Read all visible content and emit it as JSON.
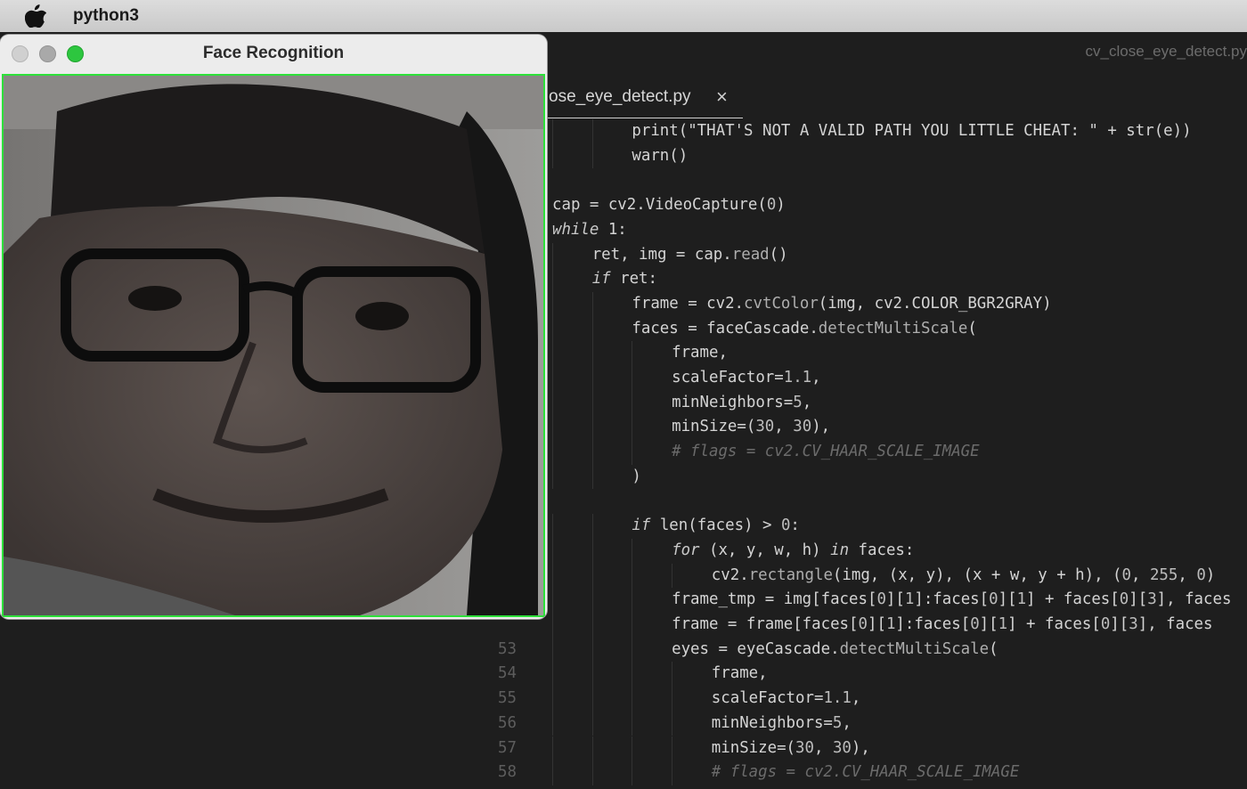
{
  "menubar": {
    "app_name": "python3"
  },
  "ide": {
    "title": "cv_close_eye_detect.py",
    "tab": {
      "label": "ose_eye_detect.py",
      "close": "×"
    }
  },
  "face_window": {
    "title": "Face Recognition"
  },
  "code_lines": [
    {
      "n": "",
      "indent": 2,
      "tokens": [
        [
          "t",
          "print(\"THAT'S NOT A VALID PATH YOU LITTLE CHEAT: \" + str(e))"
        ]
      ]
    },
    {
      "n": "",
      "indent": 2,
      "tokens": [
        [
          "t",
          "warn()"
        ]
      ]
    },
    {
      "n": "",
      "indent": 0,
      "tokens": []
    },
    {
      "n": "",
      "indent": 0,
      "tokens": [
        [
          "t",
          "cap = cv2.VideoCapture("
        ],
        [
          "num",
          "0"
        ],
        [
          "t",
          ")"
        ]
      ]
    },
    {
      "n": "",
      "indent": 0,
      "tokens": [
        [
          "kw",
          "while"
        ],
        [
          "t",
          " 1:"
        ]
      ]
    },
    {
      "n": "",
      "indent": 1,
      "tokens": [
        [
          "t",
          "ret, img = cap."
        ],
        [
          "fn",
          "read"
        ],
        [
          "t",
          "()"
        ]
      ]
    },
    {
      "n": "",
      "indent": 1,
      "tokens": [
        [
          "kw",
          "if"
        ],
        [
          "t",
          " ret:"
        ]
      ]
    },
    {
      "n": "",
      "indent": 2,
      "tokens": [
        [
          "t",
          "frame = cv2."
        ],
        [
          "fn",
          "cvtColor"
        ],
        [
          "t",
          "(img, cv2.COLOR_BGR2GRAY)"
        ]
      ]
    },
    {
      "n": "",
      "indent": 2,
      "tokens": [
        [
          "t",
          "faces = faceCascade."
        ],
        [
          "fn",
          "detectMultiScale"
        ],
        [
          "t",
          "("
        ]
      ]
    },
    {
      "n": "",
      "indent": 3,
      "tokens": [
        [
          "t",
          "frame,"
        ]
      ]
    },
    {
      "n": "",
      "indent": 3,
      "tokens": [
        [
          "t",
          "scaleFactor="
        ],
        [
          "num",
          "1.1"
        ],
        [
          "t",
          ","
        ]
      ]
    },
    {
      "n": "",
      "indent": 3,
      "tokens": [
        [
          "t",
          "minNeighbors="
        ],
        [
          "num",
          "5"
        ],
        [
          "t",
          ","
        ]
      ]
    },
    {
      "n": "",
      "indent": 3,
      "tokens": [
        [
          "t",
          "minSize=("
        ],
        [
          "num",
          "30"
        ],
        [
          "t",
          ", "
        ],
        [
          "num",
          "30"
        ],
        [
          "t",
          "),"
        ]
      ]
    },
    {
      "n": "",
      "indent": 3,
      "tokens": [
        [
          "cm",
          "# flags = cv2.CV_HAAR_SCALE_IMAGE"
        ]
      ]
    },
    {
      "n": "",
      "indent": 2,
      "tokens": [
        [
          "t",
          ")"
        ]
      ]
    },
    {
      "n": "",
      "indent": 0,
      "tokens": []
    },
    {
      "n": "",
      "indent": 2,
      "tokens": [
        [
          "kw",
          "if"
        ],
        [
          "t",
          " len(faces) > "
        ],
        [
          "num",
          "0"
        ],
        [
          "t",
          ":"
        ]
      ]
    },
    {
      "n": "",
      "indent": 3,
      "tokens": [
        [
          "kw",
          "for"
        ],
        [
          "t",
          " (x, y, w, h) "
        ],
        [
          "kw",
          "in"
        ],
        [
          "t",
          " faces:"
        ]
      ]
    },
    {
      "n": "",
      "indent": 4,
      "tokens": [
        [
          "t",
          "cv2."
        ],
        [
          "fn",
          "rectangle"
        ],
        [
          "t",
          "(img, (x, y), (x + w, y + h), ("
        ],
        [
          "num",
          "0"
        ],
        [
          "t",
          ", "
        ],
        [
          "num",
          "255"
        ],
        [
          "t",
          ", "
        ],
        [
          "num",
          "0"
        ],
        [
          "t",
          ")"
        ]
      ]
    },
    {
      "n": "",
      "indent": 3,
      "tokens": [
        [
          "t",
          "frame_tmp = img[faces["
        ],
        [
          "num",
          "0"
        ],
        [
          "t",
          "]["
        ],
        [
          "num",
          "1"
        ],
        [
          "t",
          "]:faces["
        ],
        [
          "num",
          "0"
        ],
        [
          "t",
          "]["
        ],
        [
          "num",
          "1"
        ],
        [
          "t",
          "] + faces["
        ],
        [
          "num",
          "0"
        ],
        [
          "t",
          "]["
        ],
        [
          "num",
          "3"
        ],
        [
          "t",
          "], faces"
        ]
      ]
    },
    {
      "n": "",
      "indent": 3,
      "tokens": [
        [
          "t",
          "frame = frame[faces["
        ],
        [
          "num",
          "0"
        ],
        [
          "t",
          "]["
        ],
        [
          "num",
          "1"
        ],
        [
          "t",
          "]:faces["
        ],
        [
          "num",
          "0"
        ],
        [
          "t",
          "]["
        ],
        [
          "num",
          "1"
        ],
        [
          "t",
          "] + faces["
        ],
        [
          "num",
          "0"
        ],
        [
          "t",
          "]["
        ],
        [
          "num",
          "3"
        ],
        [
          "t",
          "], faces"
        ]
      ]
    },
    {
      "n": "53",
      "indent": 3,
      "tokens": [
        [
          "t",
          "eyes = eyeCascade."
        ],
        [
          "fn",
          "detectMultiScale"
        ],
        [
          "t",
          "("
        ]
      ]
    },
    {
      "n": "54",
      "indent": 4,
      "tokens": [
        [
          "t",
          "frame,"
        ]
      ]
    },
    {
      "n": "55",
      "indent": 4,
      "tokens": [
        [
          "t",
          "scaleFactor="
        ],
        [
          "num",
          "1.1"
        ],
        [
          "t",
          ","
        ]
      ]
    },
    {
      "n": "56",
      "indent": 4,
      "tokens": [
        [
          "t",
          "minNeighbors="
        ],
        [
          "num",
          "5"
        ],
        [
          "t",
          ","
        ]
      ]
    },
    {
      "n": "57",
      "indent": 4,
      "tokens": [
        [
          "t",
          "minSize=("
        ],
        [
          "num",
          "30"
        ],
        [
          "t",
          ", "
        ],
        [
          "num",
          "30"
        ],
        [
          "t",
          "),"
        ]
      ]
    },
    {
      "n": "58",
      "indent": 4,
      "tokens": [
        [
          "cm",
          "# flags = cv2.CV_HAAR_SCALE_IMAGE"
        ]
      ]
    }
  ]
}
